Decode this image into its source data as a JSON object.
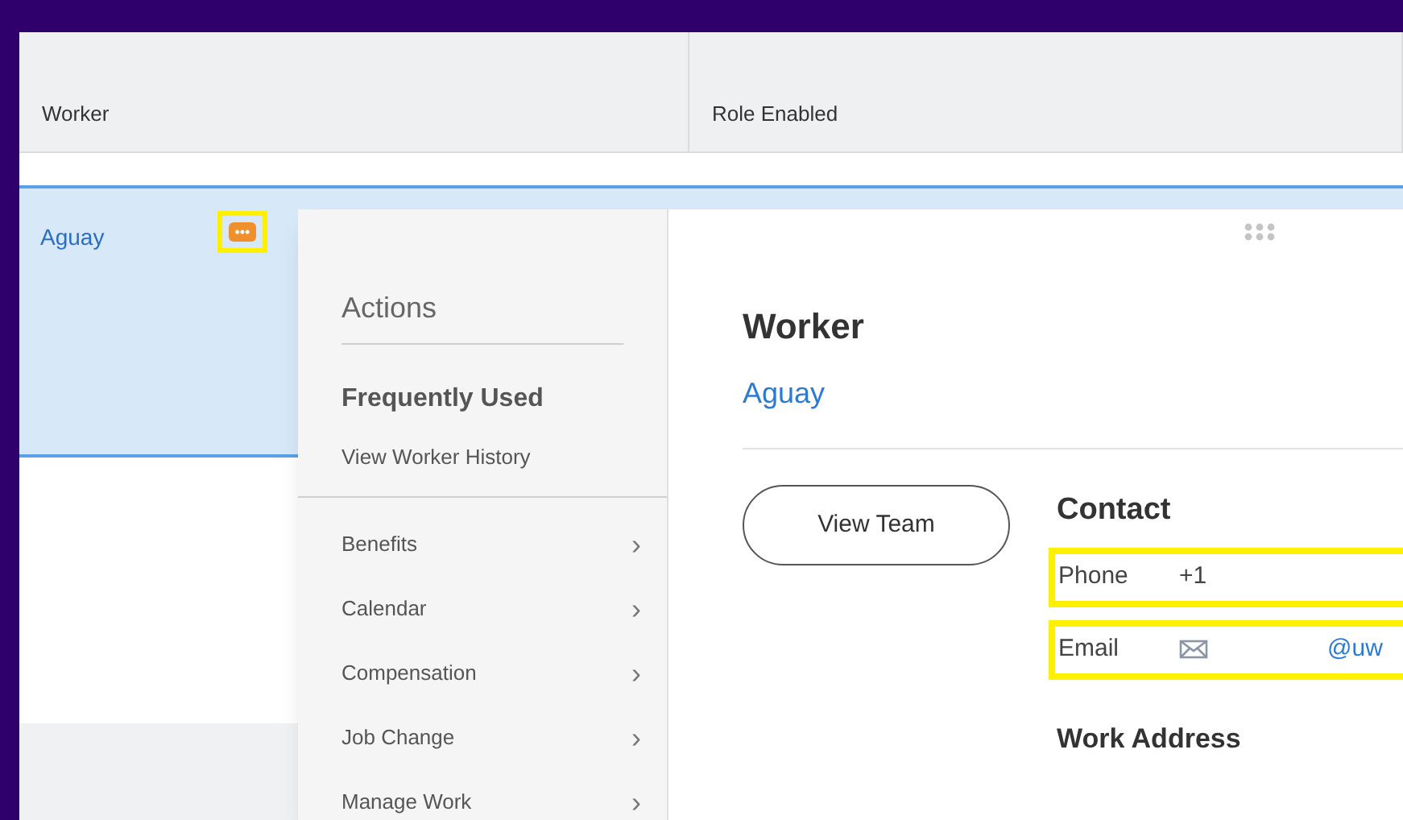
{
  "table": {
    "columns": [
      "Worker",
      "Role Enabled"
    ],
    "rows": [
      {
        "worker": "Aguay",
        "selected": true,
        "actions_button": {
          "label": "•••",
          "highlighted": true
        }
      }
    ]
  },
  "actions_menu": {
    "title": "Actions",
    "section": "Frequently Used",
    "frequent_items": [
      "View Worker History"
    ],
    "items": [
      {
        "label": "Benefits",
        "chevron": "›"
      },
      {
        "label": "Calendar",
        "chevron": "›"
      },
      {
        "label": "Compensation",
        "chevron": "›"
      },
      {
        "label": "Job Change",
        "chevron": "›"
      },
      {
        "label": "Manage Work",
        "chevron": "›"
      }
    ]
  },
  "worker_card": {
    "title": "Worker",
    "name": "Aguay",
    "button": "View Team",
    "contact_title": "Contact",
    "contact": [
      {
        "kind": "phone",
        "label": "Phone",
        "value": "+1",
        "highlighted": true
      },
      {
        "kind": "email",
        "label": "Email",
        "value": "@uw",
        "highlighted": true
      }
    ],
    "work_address_title": "Work Address"
  }
}
